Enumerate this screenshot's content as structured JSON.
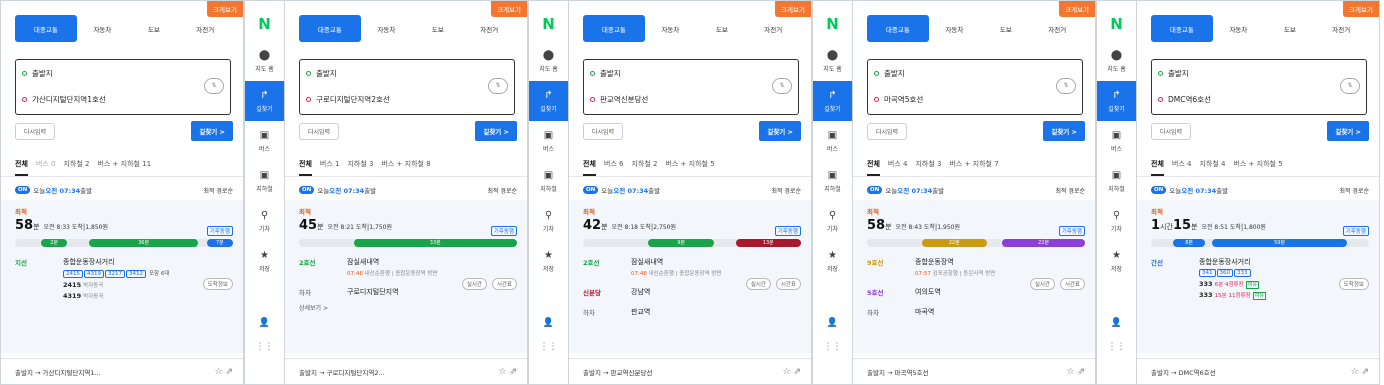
{
  "sidebar": {
    "logo": "N",
    "items": [
      {
        "icon": "map-pin-icon",
        "glyph": "⬤",
        "label": "지도 홈"
      },
      {
        "icon": "directions-icon",
        "glyph": "↱",
        "label": "길찾기"
      },
      {
        "icon": "bus-icon",
        "glyph": "▣",
        "label": "버스"
      },
      {
        "icon": "subway-icon",
        "glyph": "▣",
        "label": "지하철"
      },
      {
        "icon": "train-icon",
        "glyph": "⚲",
        "label": "기차"
      },
      {
        "icon": "star-icon",
        "glyph": "★",
        "label": "저장"
      }
    ],
    "bottom_user": "👤",
    "bottom_grid": "⋮⋮"
  },
  "common": {
    "big_view": "크게보기",
    "modes": [
      "대중교통",
      "자동차",
      "도보",
      "자전거"
    ],
    "origin": "출발지",
    "reset": "다시입력",
    "find": "길찾기 >",
    "depart_on": "ON",
    "depart_text": "오늘 ",
    "depart_time": "오전 07:34",
    "depart_suffix": " 출발",
    "sort": "최적 경로순",
    "best": "최적"
  },
  "panels": [
    {
      "dest": "가산디지털단지역1호선",
      "tabs": [
        "전체",
        "버스 0",
        "지하철 2",
        "버스 + 지하철 11"
      ],
      "time_big": "58",
      "time_unit": "분",
      "hour": "",
      "arrive": "오전 8:33 도착",
      "fare": "1,850원",
      "bar": [
        {
          "label": "2분",
          "color": "#1aa34a",
          "start": 0.12,
          "len": 0.12
        },
        {
          "label": "36분",
          "color": "#1aa34a",
          "start": 0.34,
          "len": 0.5
        },
        {
          "label": "7분",
          "color": "#1a73e8",
          "start": 0.88,
          "len": 0.12
        }
      ],
      "line": "지선",
      "line_color": "#1aa34a",
      "station": "종합운동장사거리",
      "chips": [
        "2415",
        "4319",
        "3217",
        "3412"
      ],
      "chip_extra": "포함 6대",
      "right_pill": "도착정보",
      "buses": [
        {
          "no": "2415",
          "info": "박자동곡"
        },
        {
          "no": "4319",
          "info": "박자동곡"
        }
      ],
      "foot": "출발지 → 가산디지털단지역1..."
    },
    {
      "dest": "구로디지털단지역2호선",
      "tabs": [
        "전체",
        "버스 1",
        "지하철 3",
        "버스 + 지하철 8"
      ],
      "time_big": "45",
      "time_unit": "분",
      "hour": "",
      "arrive": "오전 8:21 도착",
      "fare": "1,750원",
      "bar": [
        {
          "label": "33분",
          "color": "#1aa34a",
          "start": 0.25,
          "len": 0.75
        }
      ],
      "line": "2호선",
      "line_color": "#1aa34a",
      "station": "잠실새내역",
      "sub_time": "07:48",
      "sub_info": "내선순환행 | 종합운동장역 방면",
      "pills": [
        "실시간",
        "시간표"
      ],
      "off": "하차",
      "off_station": "구로디지털단지역",
      "more": "상세보기 >",
      "foot": "출발지 → 구로디지털단지역2..."
    },
    {
      "dest": "판교역신분당선",
      "tabs": [
        "전체",
        "버스 6",
        "지하철 2",
        "버스 + 지하철 5"
      ],
      "time_big": "42",
      "time_unit": "분",
      "hour": "",
      "arrive": "오전 8:18 도착",
      "fare": "2,750원",
      "bar": [
        {
          "label": "9분",
          "color": "#1aa34a",
          "start": 0.3,
          "len": 0.3
        },
        {
          "label": "13분",
          "color": "#a8192e",
          "start": 0.7,
          "len": 0.3
        }
      ],
      "line": "2호선",
      "line_color": "#1aa34a",
      "station": "잠실새내역",
      "sub_time": "07:48",
      "sub_info": "내선순환행 | 종합운동장역 방면",
      "pills": [
        "실시간",
        "시간표"
      ],
      "line2": "신분당",
      "line2_color": "#a8192e",
      "station2": "강남역",
      "off": "하차",
      "off_station": "판교역",
      "foot": "출발지 → 판교역신분당선"
    },
    {
      "dest": "마곡역5호선",
      "tabs": [
        "전체",
        "버스 4",
        "지하철 3",
        "버스 + 지하철 7"
      ],
      "time_big": "58",
      "time_unit": "분",
      "hour": "",
      "arrive": "오전 8:43 도착",
      "fare": "1,950원",
      "bar": [
        {
          "label": "22분",
          "color": "#c99a12",
          "start": 0.25,
          "len": 0.3
        },
        {
          "label": "22분",
          "color": "#8b3fd6",
          "start": 0.62,
          "len": 0.38
        }
      ],
      "line": "9호선",
      "line_color": "#c99a12",
      "station": "종합운동장역",
      "sub_time": "07:57",
      "sub_info": "김포공항행 | 등은사역 방면",
      "pills": [
        "실시간",
        "시간표"
      ],
      "line2": "5호선",
      "line2_color": "#8b3fd6",
      "station2": "여의도역",
      "off": "하차",
      "off_station": "마곡역",
      "foot": "출발지 → 마곡역5호선"
    },
    {
      "dest": "DMC역6호선",
      "tabs": [
        "전체",
        "버스 4",
        "지하철 4",
        "버스 + 지하철 5"
      ],
      "time_big": "15",
      "time_unit": "분",
      "hour": "1",
      "arrive": "오전 8:51 도착",
      "fare": "1,800원",
      "bar": [
        {
          "label": "8분",
          "color": "#1a73e8",
          "start": 0.1,
          "len": 0.15
        },
        {
          "label": "59분",
          "color": "#1a73e8",
          "start": 0.28,
          "len": 0.62
        }
      ],
      "line": "간선",
      "line_color": "#1a73e8",
      "station": "종합운동장사거리",
      "chips": [
        "341",
        "360",
        "333"
      ],
      "right_pill": "도착정보",
      "buses": [
        {
          "no": "333",
          "info": "6분 4정류장",
          "tag": "여유"
        },
        {
          "no": "333",
          "info": "15분 11정류장",
          "tag": "여유"
        }
      ],
      "foot": "출발지 → DMC역6호선"
    }
  ]
}
